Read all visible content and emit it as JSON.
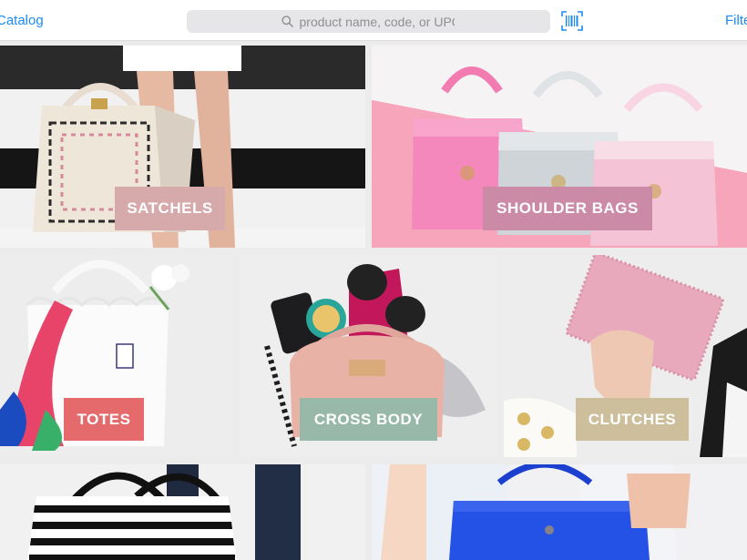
{
  "header": {
    "back_label": "Catalog",
    "search_placeholder": "product name, code, or UPC",
    "filter_label": "Filter"
  },
  "icons": {
    "search": "search-icon",
    "barcode": "barcode-scan-icon"
  },
  "colors": {
    "link": "#1a8cf2",
    "satchels_label_bg": "#d6a9ab",
    "shoulder_label_bg": "#cb8aa5",
    "totes_label_bg": "#e56a6c",
    "crossbody_label_bg": "#98b9aa",
    "clutches_label_bg": "#cdbe9c"
  },
  "categories": [
    {
      "label": "SATCHELS"
    },
    {
      "label": "SHOULDER BAGS"
    },
    {
      "label": "TOTES"
    },
    {
      "label": "CROSS BODY"
    },
    {
      "label": "CLUTCHES"
    },
    {
      "label": ""
    },
    {
      "label": ""
    }
  ]
}
